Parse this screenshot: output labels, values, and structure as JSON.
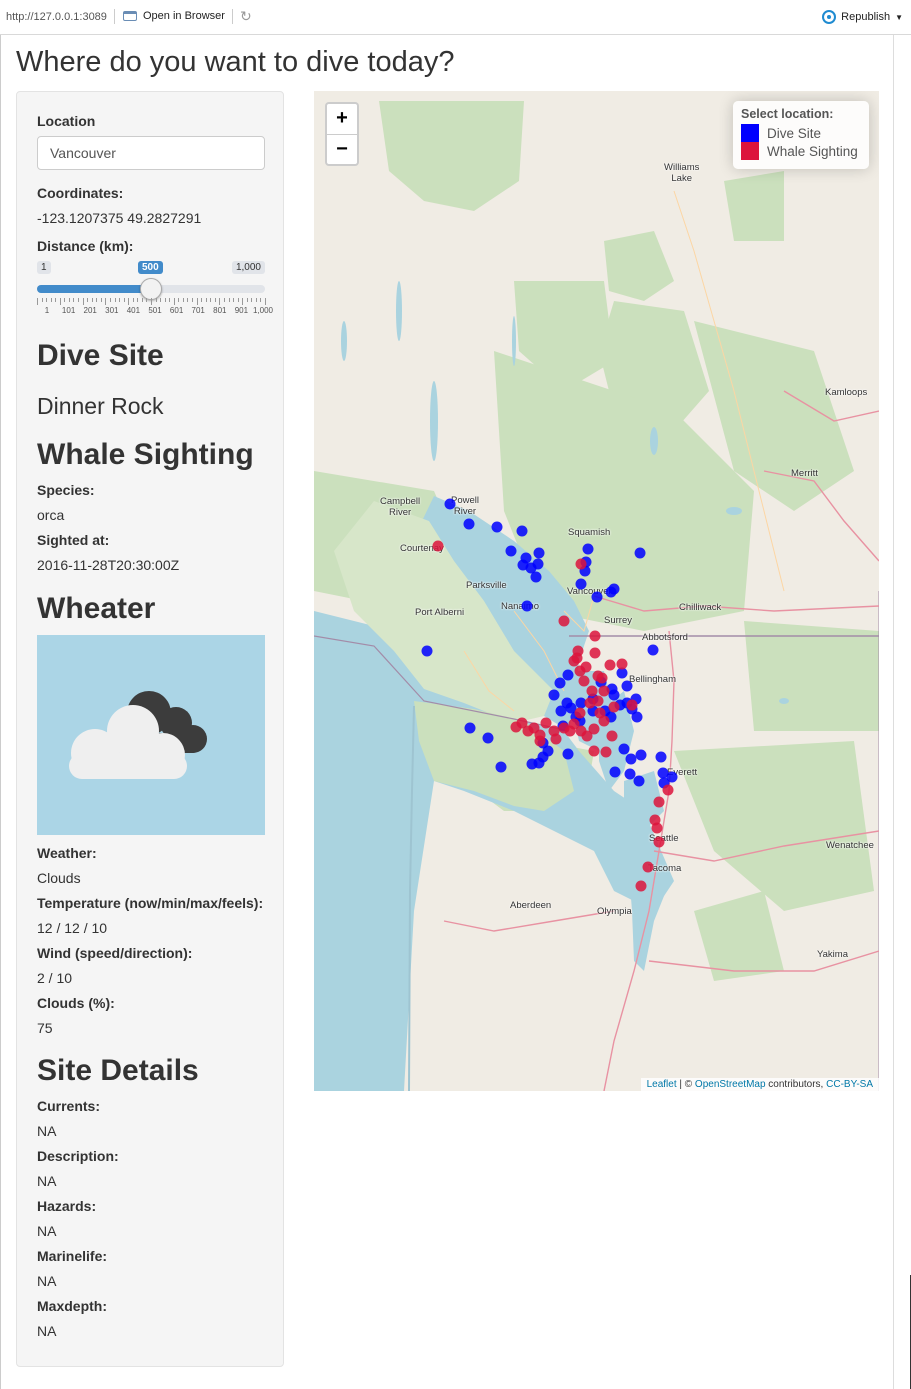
{
  "browser": {
    "url": "http://127.0.0.1:3089",
    "open_in_browser": "Open in Browser",
    "republish": "Republish"
  },
  "page": {
    "title": "Where do you want to dive today?"
  },
  "sidebar": {
    "location_label": "Location",
    "location_value": "Vancouver",
    "coordinates_label": "Coordinates:",
    "coordinates_value": "-123.1207375 49.2827291",
    "distance_label": "Distance (km):",
    "distance": {
      "min": 1,
      "max": 1000,
      "value": 500,
      "min_label": "1",
      "max_label": "1,000",
      "value_label": "500",
      "tick_labels": [
        "1",
        "101",
        "201",
        "301",
        "401",
        "501",
        "601",
        "701",
        "801",
        "901",
        "1,000"
      ]
    },
    "dive_site_heading": "Dive Site",
    "dive_site_name": "Dinner Rock",
    "whale_heading": "Whale Sighting",
    "species_label": "Species:",
    "species_value": "orca",
    "sighted_label": "Sighted at:",
    "sighted_value": "2016-11-28T20:30:00Z",
    "weather_heading": "Wheater",
    "weather_icon": "clouds-icon",
    "weather_label": "Weather:",
    "weather_value": "Clouds",
    "temperature_label": "Temperature (now/min/max/feels):",
    "temperature_value": "12 / 12 / 10",
    "wind_label": "Wind (speed/direction):",
    "wind_value": "2 / 10",
    "clouds_label": "Clouds (%):",
    "clouds_value": "75",
    "details_heading": "Site Details",
    "currents_label": "Currents:",
    "currents_value": "NA",
    "description_label": "Description:",
    "description_value": "NA",
    "hazards_label": "Hazards:",
    "hazards_value": "NA",
    "marinelife_label": "Marinelife:",
    "marinelife_value": "NA",
    "maxdepth_label": "Maxdepth:",
    "maxdepth_value": "NA"
  },
  "map": {
    "zoom_in": "+",
    "zoom_out": "−",
    "legend_title": "Select location:",
    "legend_dive": "Dive Site",
    "legend_whale": "Whale Sighting",
    "dive_color": "#0000ff",
    "whale_color": "#dc143c",
    "attribution_leaflet": "Leaflet",
    "attribution_sep": " | © ",
    "attribution_osm": "OpenStreetMap",
    "attribution_mid": " contributors, ",
    "attribution_license": "CC-BY-SA",
    "places": {
      "williams_lake": "Williams\nLake",
      "kamloops": "Kamloops",
      "merritt": "Merritt",
      "campbell_river": "Campbell\nRiver",
      "powell_river": "Powell\nRiver",
      "squamish": "Squamish",
      "courtenay": "Courtenay",
      "parksville": "Parksville",
      "vancouver": "Vancouver",
      "port_alberni": "Port Alberni",
      "nanaimo": "Nanaimo",
      "surrey": "Surrey",
      "chilliwack": "Chilliwack",
      "abbotsford": "Abbotsford",
      "bellingham": "Bellingham",
      "everett": "Everett",
      "seattle": "Seattle",
      "wenatchee": "Wenatchee",
      "tacoma": "Tacoma",
      "aberdeen": "Aberdeen",
      "olympia": "Olympia",
      "yakima": "Yakima"
    }
  }
}
